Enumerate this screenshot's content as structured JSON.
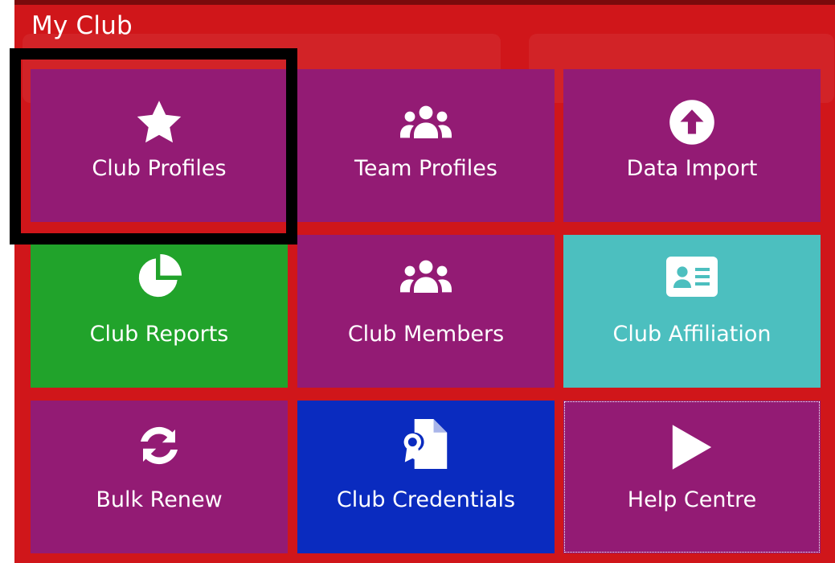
{
  "panel": {
    "title": "My Club"
  },
  "tiles": [
    {
      "label": "Club Profiles",
      "icon": "star-icon",
      "color": "#931b74"
    },
    {
      "label": "Team Profiles",
      "icon": "users-icon",
      "color": "#931b74"
    },
    {
      "label": "Data Import",
      "icon": "upload-circle-icon",
      "color": "#931b74"
    },
    {
      "label": "Club Reports",
      "icon": "pie-chart-icon",
      "color": "#21a32b"
    },
    {
      "label": "Club Members",
      "icon": "users-icon",
      "color": "#931b74"
    },
    {
      "label": "Club Affiliation",
      "icon": "id-card-icon",
      "color": "#4cbfbf"
    },
    {
      "label": "Bulk Renew",
      "icon": "sync-icon",
      "color": "#931b74"
    },
    {
      "label": "Club Credentials",
      "icon": "certificate-file-icon",
      "color": "#0a2bbf"
    },
    {
      "label": "Help Centre",
      "icon": "play-icon",
      "color": "#931b74"
    }
  ],
  "colors": {
    "panel_red": "#d0161a",
    "highlight": "#000000"
  }
}
